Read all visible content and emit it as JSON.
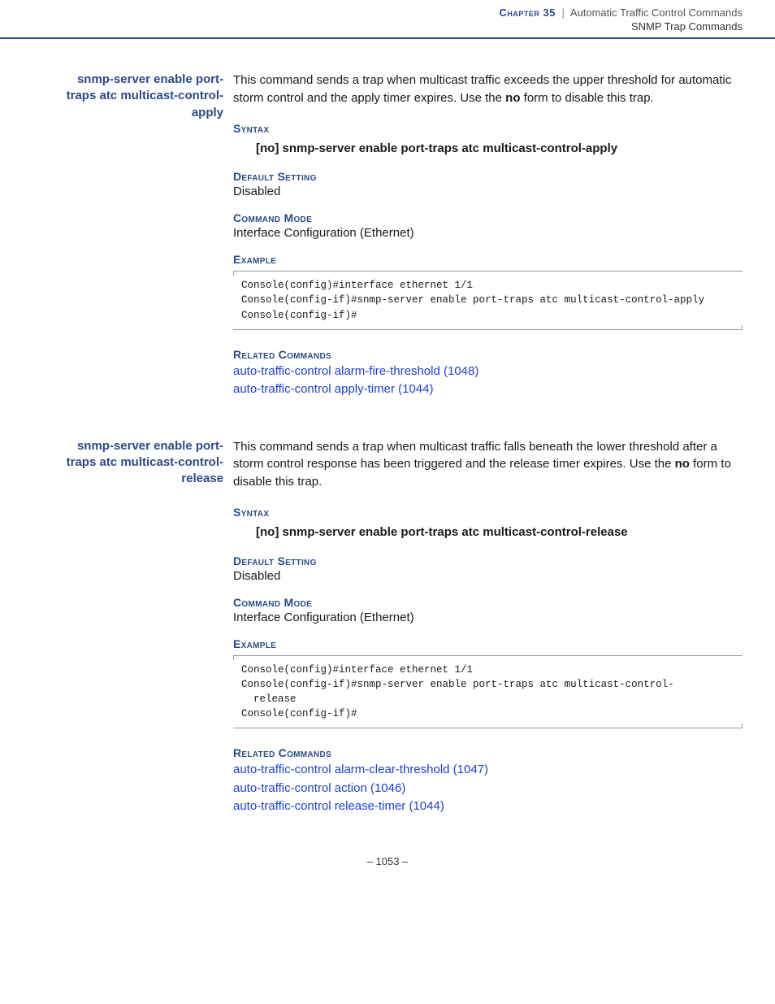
{
  "header": {
    "chapter_label": "Chapter 35",
    "separator": "|",
    "title": "Automatic Traffic Control Commands",
    "subtitle": "SNMP Trap Commands"
  },
  "entries": [
    {
      "name": "snmp-server enable port-traps atc multicast-control-apply",
      "desc_pre": "This command sends a trap when multicast traffic exceeds the upper threshold for automatic storm control and the apply timer expires. Use the ",
      "desc_bold": "no",
      "desc_post": " form to disable this trap.",
      "syntax_label": "Syntax",
      "syntax_html": "[<b>no</b>] <b>snmp-server enable port-traps atc multicast-control-apply</b>",
      "default_label": "Default Setting",
      "default_value": "Disabled",
      "mode_label": "Command Mode",
      "mode_value": "Interface Configuration (Ethernet)",
      "example_label": "Example",
      "example_code": "Console(config)#interface ethernet 1/1\nConsole(config-if)#snmp-server enable port-traps atc multicast-control-apply\nConsole(config-if)#",
      "related_label": "Related Commands",
      "related_links": [
        "auto-traffic-control alarm-fire-threshold (1048)",
        "auto-traffic-control apply-timer (1044)"
      ]
    },
    {
      "name": "snmp-server enable port-traps atc multicast-control-release",
      "desc_pre": "This command sends a trap when multicast traffic falls beneath the lower threshold after a storm control response has been triggered and the release timer expires. Use the ",
      "desc_bold": "no",
      "desc_post": " form to disable this trap.",
      "syntax_label": "Syntax",
      "syntax_html": "[<b>no</b>] <b>snmp-server enable port-traps atc multicast-control-release</b>",
      "default_label": "Default Setting",
      "default_value": "Disabled",
      "mode_label": "Command Mode",
      "mode_value": "Interface Configuration (Ethernet)",
      "example_label": "Example",
      "example_code": "Console(config)#interface ethernet 1/1\nConsole(config-if)#snmp-server enable port-traps atc multicast-control-\n  release\nConsole(config-if)#",
      "related_label": "Related Commands",
      "related_links": [
        "auto-traffic-control alarm-clear-threshold (1047)",
        "auto-traffic-control action (1046)",
        "auto-traffic-control release-timer (1044)"
      ]
    }
  ],
  "footer": {
    "page": "– 1053 –"
  }
}
